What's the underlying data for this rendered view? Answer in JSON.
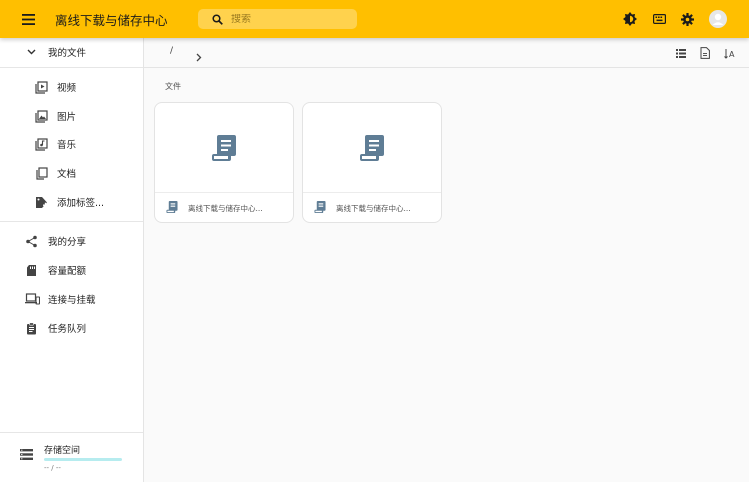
{
  "app": {
    "title": "离线下载与储存中心"
  },
  "search": {
    "placeholder": "搜索"
  },
  "topbar_icons": [
    "theme-toggle-icon",
    "keyboard-icon",
    "settings-icon",
    "account-icon"
  ],
  "sidebar": {
    "my_files": "我的文件",
    "file_types": [
      {
        "label": "视频",
        "icon": "video-file-icon"
      },
      {
        "label": "图片",
        "icon": "image-file-icon"
      },
      {
        "label": "音乐",
        "icon": "music-file-icon"
      },
      {
        "label": "文档",
        "icon": "document-file-icon"
      },
      {
        "label": "添加标签...",
        "icon": "tag-add-icon"
      }
    ],
    "items": [
      {
        "label": "我的分享",
        "icon": "share-icon"
      },
      {
        "label": "容量配额",
        "icon": "sd-card-icon"
      },
      {
        "label": "连接与挂载",
        "icon": "devices-icon"
      },
      {
        "label": "任务队列",
        "icon": "clipboard-icon"
      }
    ],
    "storage": {
      "label": "存储空间",
      "amount": "-- / --",
      "accent": "#b6ecef"
    }
  },
  "toolbar": {
    "breadcrumb_root": "/",
    "icons": [
      "list-view-icon",
      "file-info-icon",
      "sort-icon"
    ]
  },
  "main": {
    "section_title": "文件",
    "files": [
      {
        "name": "离线下载与储存中心...",
        "icon": "book-file-icon"
      },
      {
        "name": "离线下载与储存中心...",
        "icon": "book-file-icon"
      }
    ]
  },
  "colors": {
    "accent": "#ffbf00",
    "icon": "#5f7d95"
  }
}
